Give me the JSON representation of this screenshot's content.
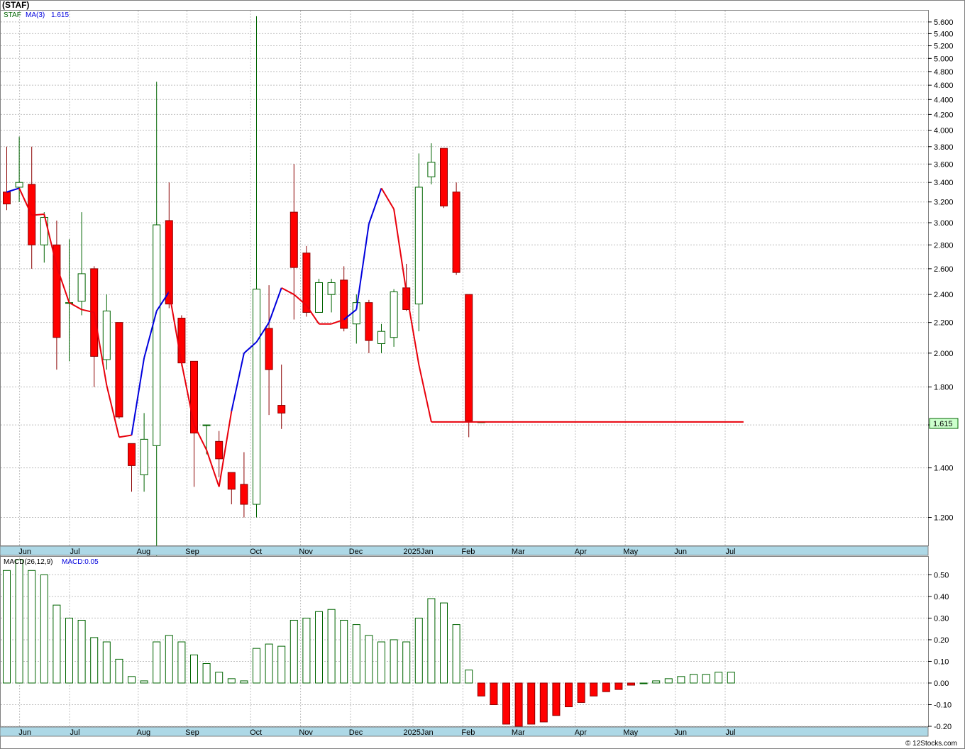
{
  "title": "(STAF)",
  "copyright": "© 12Stocks.com",
  "price_panel": {
    "legend_symbol": "STAF",
    "legend_ma": "MA(3)",
    "legend_value": "1.615",
    "last_price_label": "1.615",
    "y_ticks": [
      "5.600",
      "5.400",
      "5.200",
      "5.000",
      "4.800",
      "4.600",
      "4.400",
      "4.200",
      "4.000",
      "3.800",
      "3.600",
      "3.400",
      "3.200",
      "3.000",
      "2.800",
      "2.600",
      "2.400",
      "2.200",
      "2.000",
      "1.800",
      "1.600",
      "1.400",
      "1.200"
    ]
  },
  "macd_panel": {
    "legend_name": "MACD(26,12,9)",
    "legend_value": "MACD:0.05",
    "y_ticks": [
      "0.50",
      "0.40",
      "0.30",
      "0.20",
      "0.10",
      "0.00",
      "-0.10",
      "-0.20"
    ]
  },
  "months": [
    "Jun",
    "Jul",
    "Aug",
    "Sep",
    "Oct",
    "Nov",
    "Dec",
    "2025Jan",
    "Feb",
    "Mar",
    "Apr",
    "May",
    "Jun",
    "Jul"
  ],
  "colors": {
    "up": "#ffffff",
    "up_stroke": "#006400",
    "down": "#ff0000",
    "down_stroke": "#8b0000",
    "ma_red": "#e8000b",
    "ma_blue": "#0000dd",
    "axis_bar": "#add8e6",
    "grid": "#c0c0c0"
  },
  "chart_data": [
    {
      "type": "candlestick",
      "title": "(STAF)",
      "scale": "log",
      "ylim": [
        1.1,
        5.8
      ],
      "series_name": "STAF",
      "ma_name": "MA(3)",
      "candles": [
        {
          "o": 3.3,
          "h": 3.8,
          "l": 3.12,
          "c": 3.18
        },
        {
          "o": 3.35,
          "h": 3.92,
          "l": 3.2,
          "c": 3.4
        },
        {
          "o": 3.38,
          "h": 3.8,
          "l": 2.6,
          "c": 2.8
        },
        {
          "o": 2.8,
          "h": 3.1,
          "l": 2.65,
          "c": 3.05
        },
        {
          "o": 2.8,
          "h": 3.02,
          "l": 1.9,
          "c": 2.1
        },
        {
          "o": 2.34,
          "h": 2.85,
          "l": 1.95,
          "c": 2.34
        },
        {
          "o": 2.35,
          "h": 3.1,
          "l": 2.25,
          "c": 2.56
        },
        {
          "o": 2.6,
          "h": 2.62,
          "l": 1.8,
          "c": 1.98
        },
        {
          "o": 1.96,
          "h": 2.4,
          "l": 1.9,
          "c": 2.28
        },
        {
          "o": 2.2,
          "h": 2.2,
          "l": 1.63,
          "c": 1.64
        },
        {
          "o": 1.51,
          "h": 1.51,
          "l": 1.3,
          "c": 1.41
        },
        {
          "o": 1.37,
          "h": 1.66,
          "l": 1.3,
          "c": 1.53
        },
        {
          "o": 1.5,
          "h": 4.65,
          "l": 1.05,
          "c": 2.98
        },
        {
          "o": 3.02,
          "h": 3.4,
          "l": 2.3,
          "c": 2.33
        },
        {
          "o": 2.23,
          "h": 2.25,
          "l": 1.92,
          "c": 1.94
        },
        {
          "o": 1.95,
          "h": 1.95,
          "l": 1.32,
          "c": 1.56
        },
        {
          "o": 1.6,
          "h": 1.6,
          "l": 1.46,
          "c": 1.6
        },
        {
          "o": 1.52,
          "h": 1.57,
          "l": 1.36,
          "c": 1.44
        },
        {
          "o": 1.38,
          "h": 1.38,
          "l": 1.25,
          "c": 1.31
        },
        {
          "o": 1.33,
          "h": 1.47,
          "l": 1.2,
          "c": 1.25
        },
        {
          "o": 1.25,
          "h": 5.7,
          "l": 1.2,
          "c": 2.44
        },
        {
          "o": 2.16,
          "h": 2.47,
          "l": 1.65,
          "c": 1.9
        },
        {
          "o": 1.7,
          "h": 1.93,
          "l": 1.58,
          "c": 1.66
        },
        {
          "o": 3.1,
          "h": 3.6,
          "l": 2.22,
          "c": 2.61
        },
        {
          "o": 2.73,
          "h": 2.79,
          "l": 2.24,
          "c": 2.27
        },
        {
          "o": 2.27,
          "h": 2.52,
          "l": 2.27,
          "c": 2.49
        },
        {
          "o": 2.4,
          "h": 2.52,
          "l": 2.27,
          "c": 2.49
        },
        {
          "o": 2.51,
          "h": 2.62,
          "l": 2.14,
          "c": 2.16
        },
        {
          "o": 2.19,
          "h": 2.4,
          "l": 2.06,
          "c": 2.34
        },
        {
          "o": 2.34,
          "h": 2.36,
          "l": 2.0,
          "c": 2.08
        },
        {
          "o": 2.06,
          "h": 2.19,
          "l": 2.0,
          "c": 2.14
        },
        {
          "o": 2.1,
          "h": 2.44,
          "l": 2.04,
          "c": 2.42
        },
        {
          "o": 2.45,
          "h": 2.64,
          "l": 2.28,
          "c": 2.29
        },
        {
          "o": 2.33,
          "h": 3.72,
          "l": 2.14,
          "c": 3.35
        },
        {
          "o": 3.46,
          "h": 3.84,
          "l": 3.38,
          "c": 3.62
        },
        {
          "o": 3.78,
          "h": 3.78,
          "l": 3.14,
          "c": 3.16
        },
        {
          "o": 3.3,
          "h": 3.4,
          "l": 2.55,
          "c": 2.57
        },
        {
          "o": 2.4,
          "h": 2.4,
          "l": 1.54,
          "c": 1.62
        },
        {
          "o": 1.615,
          "h": 1.615,
          "l": 1.615,
          "c": 1.615
        }
      ],
      "ma": [
        3.3,
        3.34,
        3.07,
        3.08,
        2.62,
        2.34,
        2.29,
        2.27,
        1.81,
        1.54,
        1.55,
        1.97,
        2.28,
        2.42,
        1.94,
        1.6,
        1.48,
        1.32,
        1.67,
        2.0,
        2.07,
        2.2,
        2.45,
        2.4,
        2.32,
        2.19,
        2.19,
        2.22,
        2.29,
        2.99,
        3.34,
        3.13,
        2.42,
        1.93,
        1.615
      ],
      "ma_colors": [
        "blue",
        "blue",
        "red",
        "red",
        "red",
        "red",
        "red",
        "red",
        "red",
        "red",
        "red",
        "blue",
        "blue",
        "blue",
        "red",
        "red",
        "red",
        "red",
        "red",
        "blue",
        "blue",
        "blue",
        "blue",
        "red",
        "red",
        "red",
        "red",
        "red",
        "blue",
        "blue",
        "blue",
        "red",
        "red",
        "red",
        "red"
      ],
      "ma_flat_until_index": 59,
      "last_value": 1.615
    },
    {
      "type": "bar",
      "title": "MACD(26,12,9)",
      "ylim": [
        -0.2,
        0.58
      ],
      "values": [
        0.52,
        0.57,
        0.52,
        0.5,
        0.36,
        0.3,
        0.29,
        0.21,
        0.19,
        0.11,
        0.03,
        0.01,
        0.19,
        0.22,
        0.19,
        0.13,
        0.09,
        0.05,
        0.02,
        0.01,
        0.16,
        0.18,
        0.17,
        0.29,
        0.3,
        0.33,
        0.34,
        0.29,
        0.27,
        0.22,
        0.19,
        0.2,
        0.19,
        0.3,
        0.39,
        0.37,
        0.27,
        0.06,
        -0.06,
        -0.1,
        -0.19,
        -0.2,
        -0.19,
        -0.18,
        -0.15,
        -0.11,
        -0.09,
        -0.06,
        -0.04,
        -0.03,
        -0.01,
        0.0,
        0.01,
        0.02,
        0.03,
        0.04,
        0.04,
        0.05,
        0.05
      ]
    }
  ]
}
